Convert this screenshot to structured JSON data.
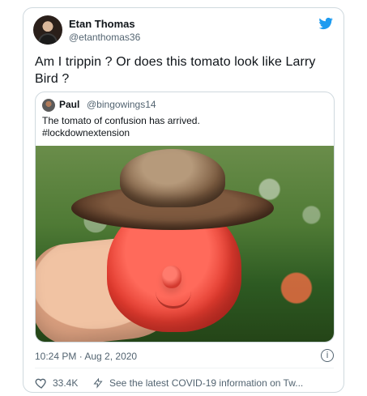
{
  "tweet": {
    "author": {
      "name": "Etan Thomas",
      "handle": "@etanthomas36"
    },
    "text": "Am I trippin ? Or does this tomato look like Larry Bird ?",
    "quoted": {
      "author": {
        "name": "Paul",
        "handle": "@bingowings14"
      },
      "lines": [
        "The tomato of confusion has arrived.",
        "#lockdownextension"
      ]
    },
    "timestamp": "10:24 PM · Aug 2, 2020",
    "likes": "33.4K",
    "covid_link": "See the latest COVID-19 information on Tw..."
  },
  "colors": {
    "brand": "#1d9bf0",
    "border": "#cfd9de",
    "muted": "#536471",
    "text": "#0f1419"
  },
  "icons": {
    "twitter_bird": "twitter-bird-icon",
    "info": "info-icon",
    "like": "heart-icon",
    "covid": "lightning-icon"
  }
}
